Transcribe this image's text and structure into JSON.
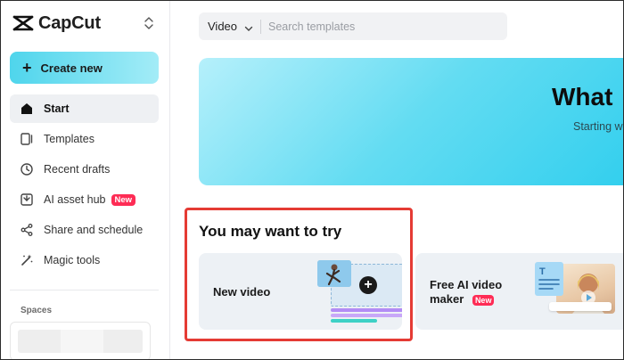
{
  "app": {
    "name": "CapCut"
  },
  "sidebar": {
    "create_label": "Create new",
    "items": [
      {
        "label": "Start",
        "icon": "home-icon",
        "active": true
      },
      {
        "label": "Templates",
        "icon": "templates-icon"
      },
      {
        "label": "Recent drafts",
        "icon": "clock-icon"
      },
      {
        "label": "AI asset hub",
        "icon": "asset-hub-icon",
        "badge": "New"
      },
      {
        "label": "Share and schedule",
        "icon": "share-icon"
      },
      {
        "label": "Magic tools",
        "icon": "magic-wand-icon"
      }
    ],
    "spaces_label": "Spaces"
  },
  "search": {
    "type_label": "Video",
    "placeholder": "Search templates"
  },
  "hero": {
    "title": "What",
    "subtitle": "Starting w"
  },
  "try_section": {
    "title": "You may want to try",
    "cards": [
      {
        "label": "New video"
      },
      {
        "label": "Free AI video maker",
        "badge": "New"
      }
    ]
  },
  "colors": {
    "accent": "#4fd5ec",
    "badge": "#fe2c55",
    "highlight_box": "#e53b34"
  }
}
